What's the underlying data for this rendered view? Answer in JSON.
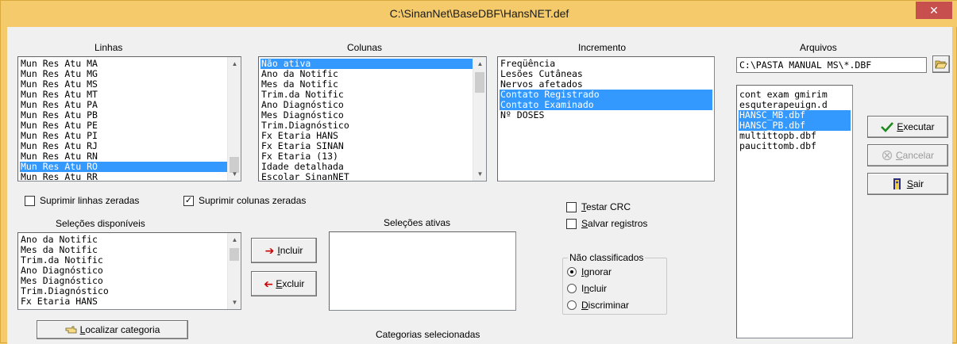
{
  "window": {
    "title": "C:\\SinanNet\\BaseDBF\\HansNET.def",
    "close_glyph": "✕"
  },
  "linhas": {
    "label": "Linhas",
    "items": [
      "Mun Res Atu MA",
      "Mun Res Atu MG",
      "Mun Res Atu MS",
      "Mun Res Atu MT",
      "Mun Res Atu PA",
      "Mun Res Atu PB",
      "Mun Res Atu PE",
      "Mun Res Atu PI",
      "Mun Res Atu RJ",
      "Mun Res Atu RN",
      "Mun Res Atu RO",
      "Mun Res Atu RR"
    ],
    "selected": "Mun Res Atu RO"
  },
  "colunas": {
    "label": "Colunas",
    "items": [
      "Não ativa",
      "Ano da Notific",
      "Mes da Notific",
      "Trim.da Notific",
      "Ano Diagnóstico",
      "Mes Diagnóstico",
      "Trim.Diagnóstico",
      "Fx Etaria HANS",
      "Fx Etaria SINAN",
      "Fx Etaria (13)",
      "Idade detalhada",
      "Escolar SinanNET"
    ],
    "selected": "Não ativa"
  },
  "incremento": {
    "label": "Incremento",
    "items": [
      "Freqüência",
      "Lesões Cutâneas",
      "Nervos afetados",
      "Contato Registrado",
      "Contato Examinado",
      "Nº DOSES"
    ],
    "selected": [
      "Contato Registrado",
      "Contato Examinado"
    ]
  },
  "arquivos": {
    "label": "Arquivos",
    "path": "C:\\PASTA MANUAL MS\\*.DBF",
    "items": [
      "cont exam gmirim",
      "esquterapeuign.d",
      "HANSC_MB.dbf",
      "HANSC_PB.dbf",
      "multittopb.dbf",
      "paucittomb.dbf"
    ],
    "selected": [
      "HANSC_MB.dbf",
      "HANSC_PB.dbf"
    ]
  },
  "options": {
    "suprimir_linhas": {
      "label": "Suprimir linhas zeradas",
      "checked": false,
      "mark": ""
    },
    "suprimir_colunas": {
      "label": "Suprimir colunas zeradas",
      "checked": true,
      "mark": "✓"
    },
    "testar_crc": {
      "label": "Testar CRC",
      "checked": false,
      "mark": ""
    },
    "salvar_registros": {
      "label": "Salvar registros",
      "checked": false,
      "mark": ""
    }
  },
  "selecoes_disponiveis": {
    "label": "Seleções disponíveis",
    "items": [
      "Ano da Notific",
      "Mes da Notific",
      "Trim.da Notific",
      "Ano Diagnóstico",
      "Mes Diagnóstico",
      "Trim.Diagnóstico",
      "Fx Etaria HANS"
    ]
  },
  "selecoes_ativas": {
    "label": "Seleções ativas"
  },
  "buttons": {
    "incluir": "Incluir",
    "excluir": "Excluir",
    "executar": "Executar",
    "cancelar": "Cancelar",
    "sair": "Sair",
    "localizar": "Localizar categoria"
  },
  "nao_classificados": {
    "label": "Não classificados",
    "options": [
      "Ignorar",
      "Incluir",
      "Discriminar"
    ],
    "selected": "Ignorar"
  },
  "categorias_label": "Categorias selecionadas",
  "colors": {
    "title_bar": "#f4ca6a",
    "selection": "#3399ff",
    "close_button": "#c74f4d",
    "client_bg": "#f0f0f0"
  }
}
